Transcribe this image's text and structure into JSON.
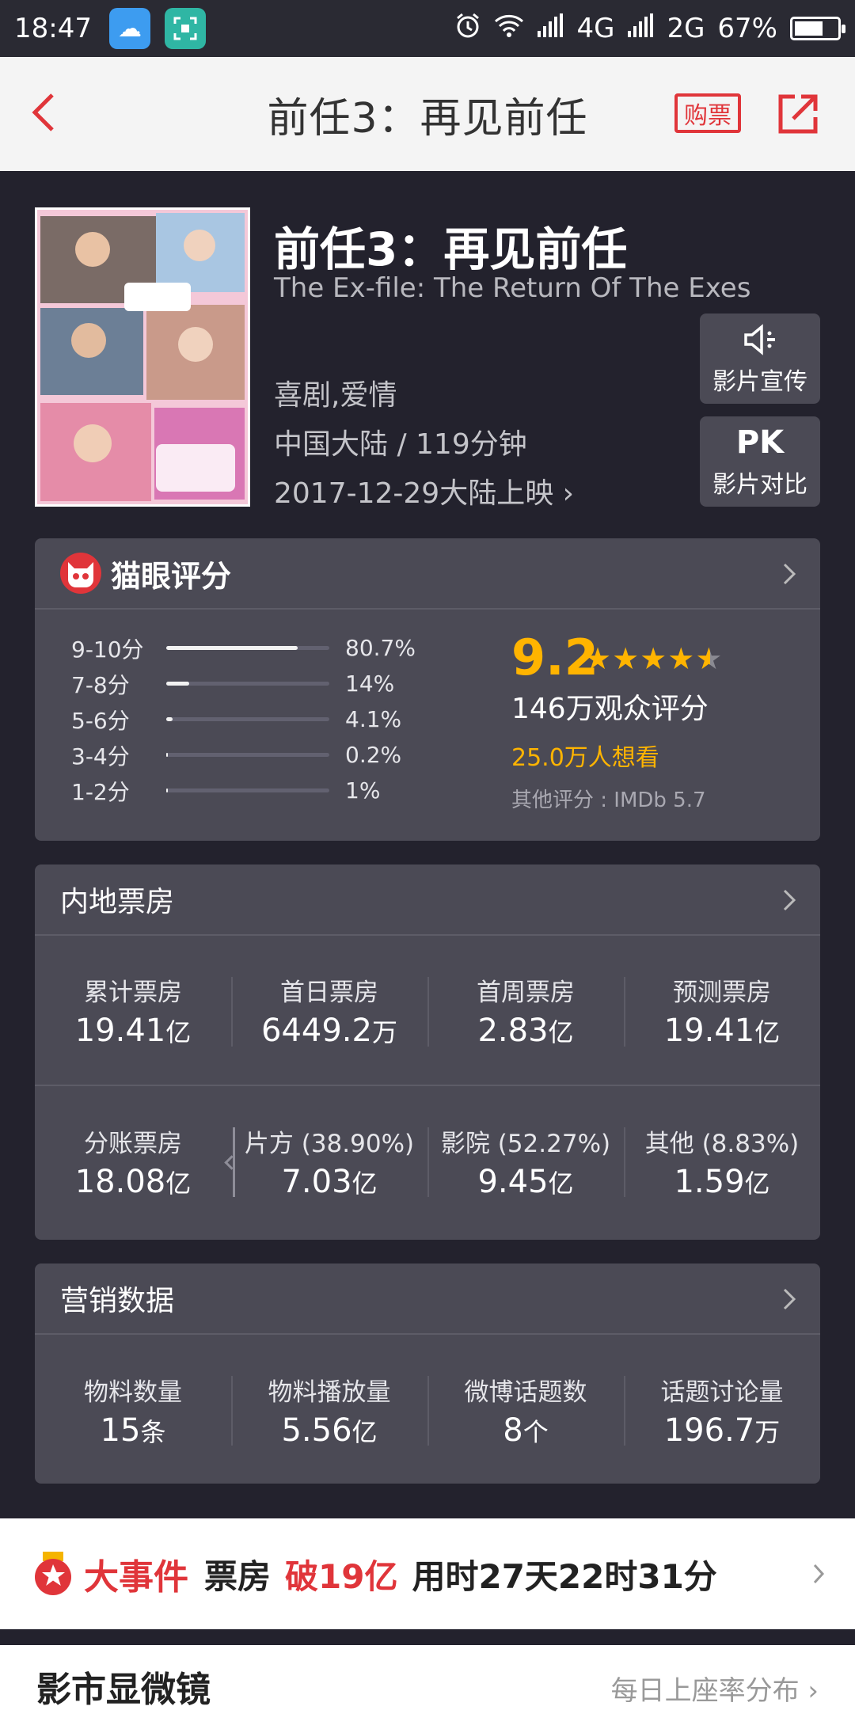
{
  "status_bar": {
    "time": "18:47",
    "network1": "4G",
    "network2": "2G",
    "battery": "67%",
    "battery_level": 0.67
  },
  "nav": {
    "title": "前任3：再见前任",
    "buy_label": "购票"
  },
  "movie": {
    "title_cn": "前任3：再见前任",
    "title_en": "The Ex-file: The Return Of The Exes",
    "genre": "喜剧,爱情",
    "region_duration": "中国大陆 / 119分钟",
    "release": "2017-12-29大陆上映 ›",
    "promo_label": "影片宣传",
    "pk_icon": "PK",
    "pk_label": "影片对比"
  },
  "rating": {
    "title": "猫眼评分",
    "score": "9.2",
    "score_value": 9.2,
    "viewers": "146万观众评分",
    "wish": "25.0万人想看",
    "other": "其他评分 : IMDb 5.7",
    "distribution": [
      {
        "label": "9-10分",
        "pct": "80.7%",
        "value": 80.7
      },
      {
        "label": "7-8分",
        "pct": "14%",
        "value": 14
      },
      {
        "label": "5-6分",
        "pct": "4.1%",
        "value": 4.1
      },
      {
        "label": "3-4分",
        "pct": "0.2%",
        "value": 0.2
      },
      {
        "label": "1-2分",
        "pct": "1%",
        "value": 1
      }
    ]
  },
  "box_office": {
    "title": "内地票房",
    "row1": [
      {
        "label": "累计票房",
        "value": "19.41",
        "unit": "亿"
      },
      {
        "label": "首日票房",
        "value": "6449.2",
        "unit": "万"
      },
      {
        "label": "首周票房",
        "value": "2.83",
        "unit": "亿"
      },
      {
        "label": "预测票房",
        "value": "19.41",
        "unit": "亿"
      }
    ],
    "row2": [
      {
        "label": "分账票房",
        "value": "18.08",
        "unit": "亿"
      },
      {
        "label": "片方 (38.90%)",
        "value": "7.03",
        "unit": "亿"
      },
      {
        "label": "影院 (52.27%)",
        "value": "9.45",
        "unit": "亿"
      },
      {
        "label": "其他 (8.83%)",
        "value": "1.59",
        "unit": "亿"
      }
    ]
  },
  "marketing": {
    "title": "营销数据",
    "items": [
      {
        "label": "物料数量",
        "value": "15",
        "unit": "条"
      },
      {
        "label": "物料播放量",
        "value": "5.56",
        "unit": "亿"
      },
      {
        "label": "微博话题数",
        "value": "8",
        "unit": "个"
      },
      {
        "label": "话题讨论量",
        "value": "196.7",
        "unit": "万"
      }
    ]
  },
  "event": {
    "tag": "大事件",
    "text1": "票房",
    "highlight": "破19亿",
    "text2": "用时27天22时31分"
  },
  "bottom": {
    "title": "影市显微镜",
    "link": "每日上座率分布 ›"
  },
  "colors": {
    "accent_red": "#e0353a",
    "score_yellow": "#ffb400",
    "background": "#23222d",
    "card": "#4b4a55"
  }
}
